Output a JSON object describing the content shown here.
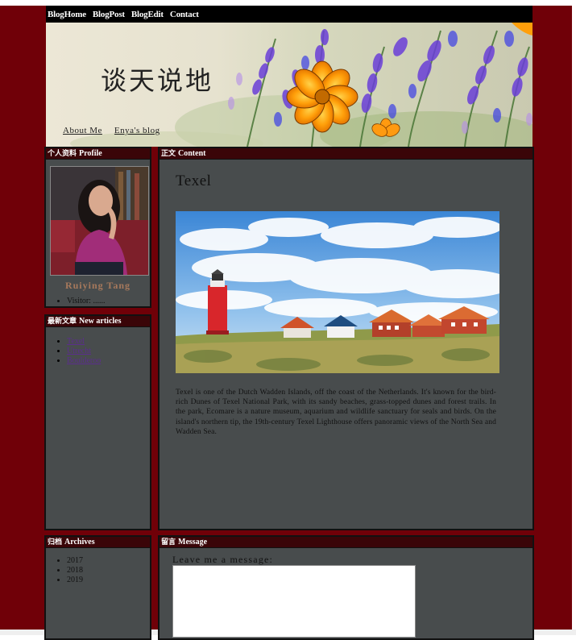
{
  "nav": {
    "items": [
      {
        "label": "BlogHome"
      },
      {
        "label": "BlogPost"
      },
      {
        "label": "BlogEdit"
      },
      {
        "label": "Contact"
      }
    ]
  },
  "banner": {
    "title": "谈天说地",
    "links": [
      {
        "label": "About Me"
      },
      {
        "label": "Enya's blog"
      }
    ]
  },
  "profile": {
    "heading_cn": "个人资料",
    "heading_en": "Profile",
    "name": "Ruiying Tang",
    "visitor": "Visitor: ......"
  },
  "new_articles": {
    "heading_cn": "最新文章",
    "heading_en": "New articles",
    "items": [
      "Texel",
      "Utrecht",
      "Boulderoo"
    ]
  },
  "content": {
    "heading_cn": "正文",
    "heading_en": "Content",
    "post_title": "Texel",
    "post_body": "Texel is one of the Dutch Wadden Islands, off the coast of the Netherlands. It's known for the bird-rich Dunes of Texel National Park, with its sandy beaches, grass-topped dunes and forest trails. In the park, Ecomare is a nature museum, aquarium and wildlife sanctuary for seals and birds. On the island's northern tip, the 19th-century Texel Lighthouse offers panoramic views of the North Sea and Wadden Sea."
  },
  "archives": {
    "heading_cn": "归档",
    "heading_en": "Archives",
    "years": [
      "2017",
      "2018",
      "2019"
    ]
  },
  "message": {
    "heading_cn": "留言",
    "heading_en": "Message",
    "label": "Leave me a message:",
    "value": ""
  },
  "colors": {
    "page_background": "#700008",
    "panel_background": "#484c4d",
    "panel_header": "#3a0508",
    "profile_name": "#a7795c",
    "link_visited": "#5b2d8d"
  }
}
